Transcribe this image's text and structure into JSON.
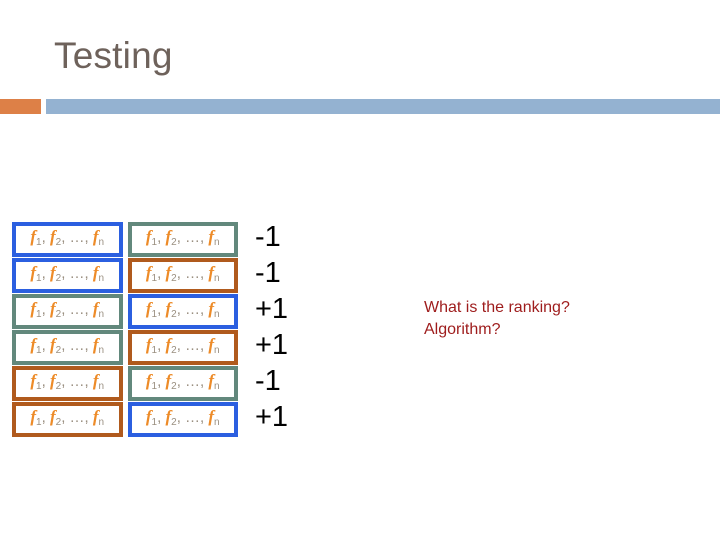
{
  "slide": {
    "title": "Testing",
    "accent_orange": "#dd8047",
    "accent_blue": "#94b2d1",
    "title_color": "#6e625b"
  },
  "feature_table": {
    "cell_text_prefix": "f",
    "cell_text_full": "f1, f2, …, fn",
    "border_colors": {
      "blue": "#2b5fe0",
      "teal": "#62887c",
      "brown": "#b05a1d"
    },
    "rows": [
      {
        "left": {
          "text": "f1, f2, …, fn",
          "border": "blue"
        },
        "right": {
          "text": "f1, f2, …, fn",
          "border": "teal"
        }
      },
      {
        "left": {
          "text": "f1, f2, …, fn",
          "border": "blue"
        },
        "right": {
          "text": "f1, f2, …, fn",
          "border": "brown"
        }
      },
      {
        "left": {
          "text": "f1, f2, …, fn",
          "border": "teal"
        },
        "right": {
          "text": "f1, f2, …, fn",
          "border": "blue"
        }
      },
      {
        "left": {
          "text": "f1, f2, …, fn",
          "border": "teal"
        },
        "right": {
          "text": "f1, f2, …, fn",
          "border": "brown"
        }
      },
      {
        "left": {
          "text": "f1, f2, …, fn",
          "border": "brown"
        },
        "right": {
          "text": "f1, f2, …, fn",
          "border": "teal"
        }
      },
      {
        "left": {
          "text": "f1, f2, …, fn",
          "border": "brown"
        },
        "right": {
          "text": "f1, f2, …, fn",
          "border": "blue"
        }
      }
    ]
  },
  "labels": {
    "values": [
      "-1",
      "-1",
      "+1",
      "+1",
      "-1",
      "+1"
    ],
    "color": "#000000"
  },
  "question_note": {
    "color": "#9e1c1c",
    "lines": [
      "What is the ranking?",
      "Algorithm?"
    ]
  }
}
